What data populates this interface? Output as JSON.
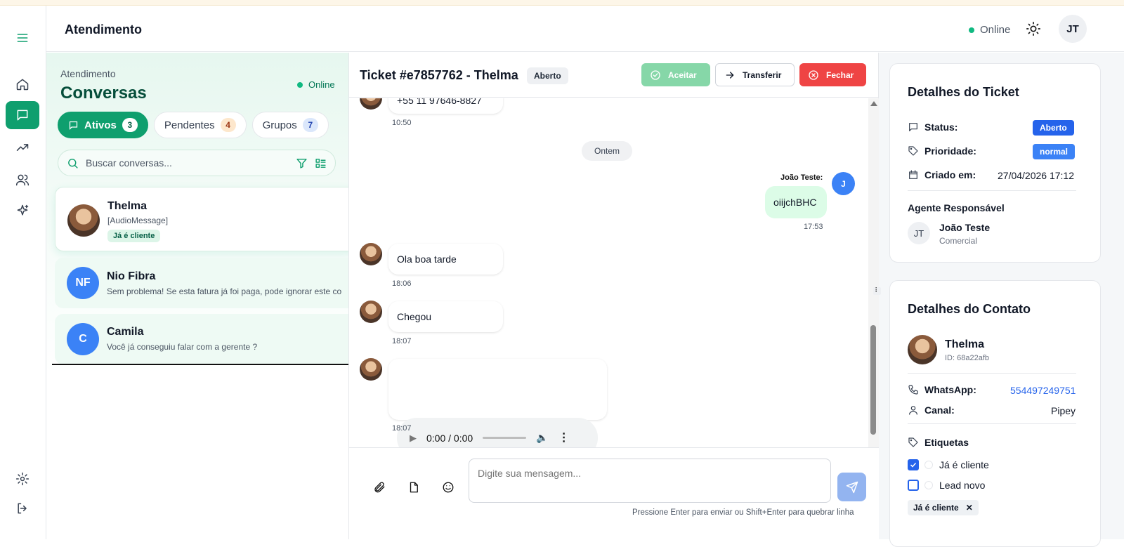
{
  "header": {
    "title": "Atendimento",
    "status": "Online",
    "user_initials": "JT"
  },
  "conversations": {
    "subtitle": "Atendimento",
    "title": "Conversas",
    "status": "Online",
    "tabs": [
      {
        "label": "Ativos",
        "count": "3"
      },
      {
        "label": "Pendentes",
        "count": "4"
      },
      {
        "label": "Grupos",
        "count": "7"
      }
    ],
    "search_placeholder": "Buscar conversas...",
    "items": [
      {
        "name": "Thelma",
        "preview": "[AudioMessage]",
        "tag": "Já é cliente"
      },
      {
        "name": "Nio Fibra",
        "initials": "NF",
        "preview": "Sem problema! Se esta fatura já foi paga, pode ignorar este co"
      },
      {
        "name": "Camila",
        "initials": "C",
        "preview": "Você já conseguiu falar com a gerente ?"
      }
    ]
  },
  "chat": {
    "title": "Ticket #e7857762 - Thelma",
    "status": "Aberto",
    "accept_label": "Aceitar",
    "transfer_label": "Transferir",
    "close_label": "Fechar",
    "messages": [
      {
        "text": "+55 11 97646-8827",
        "time": "10:50"
      },
      {
        "separator": "Ontem"
      },
      {
        "sender": "João Teste:",
        "sender_initial": "J",
        "text": "oiijchBHC",
        "time": "17:53"
      },
      {
        "text": "Ola boa tarde",
        "time": "18:06"
      },
      {
        "text": "Chegou",
        "time": "18:07"
      },
      {
        "audio_time": "0:00 / 0:00",
        "time": "18:07"
      }
    ],
    "input_placeholder": "Digite sua mensagem...",
    "hint": "Pressione Enter para enviar ou Shift+Enter para quebrar linha"
  },
  "ticket_details": {
    "title": "Detalhes do Ticket",
    "status_label": "Status:",
    "status_value": "Aberto",
    "priority_label": "Prioridade:",
    "priority_value": "normal",
    "created_label": "Criado em:",
    "created_value": "27/04/2026 17:12",
    "agent_section": "Agente Responsável",
    "agent_initials": "JT",
    "agent_name": "João Teste",
    "agent_team": "Comercial"
  },
  "contact_details": {
    "title": "Detalhes do Contato",
    "name": "Thelma",
    "id": "ID: 68a22afb",
    "whatsapp_label": "WhatsApp:",
    "whatsapp_value": "554497249751",
    "channel_label": "Canal:",
    "channel_value": "Pipey",
    "tags_label": "Etiquetas",
    "tags": [
      {
        "label": "Já é cliente",
        "checked": true
      },
      {
        "label": "Lead novo",
        "checked": false
      }
    ],
    "selected_tag": "Já é cliente"
  },
  "colors": {
    "accent": "#0f9f6e",
    "danger": "#ef4444",
    "primary_blue": "#2563eb"
  }
}
